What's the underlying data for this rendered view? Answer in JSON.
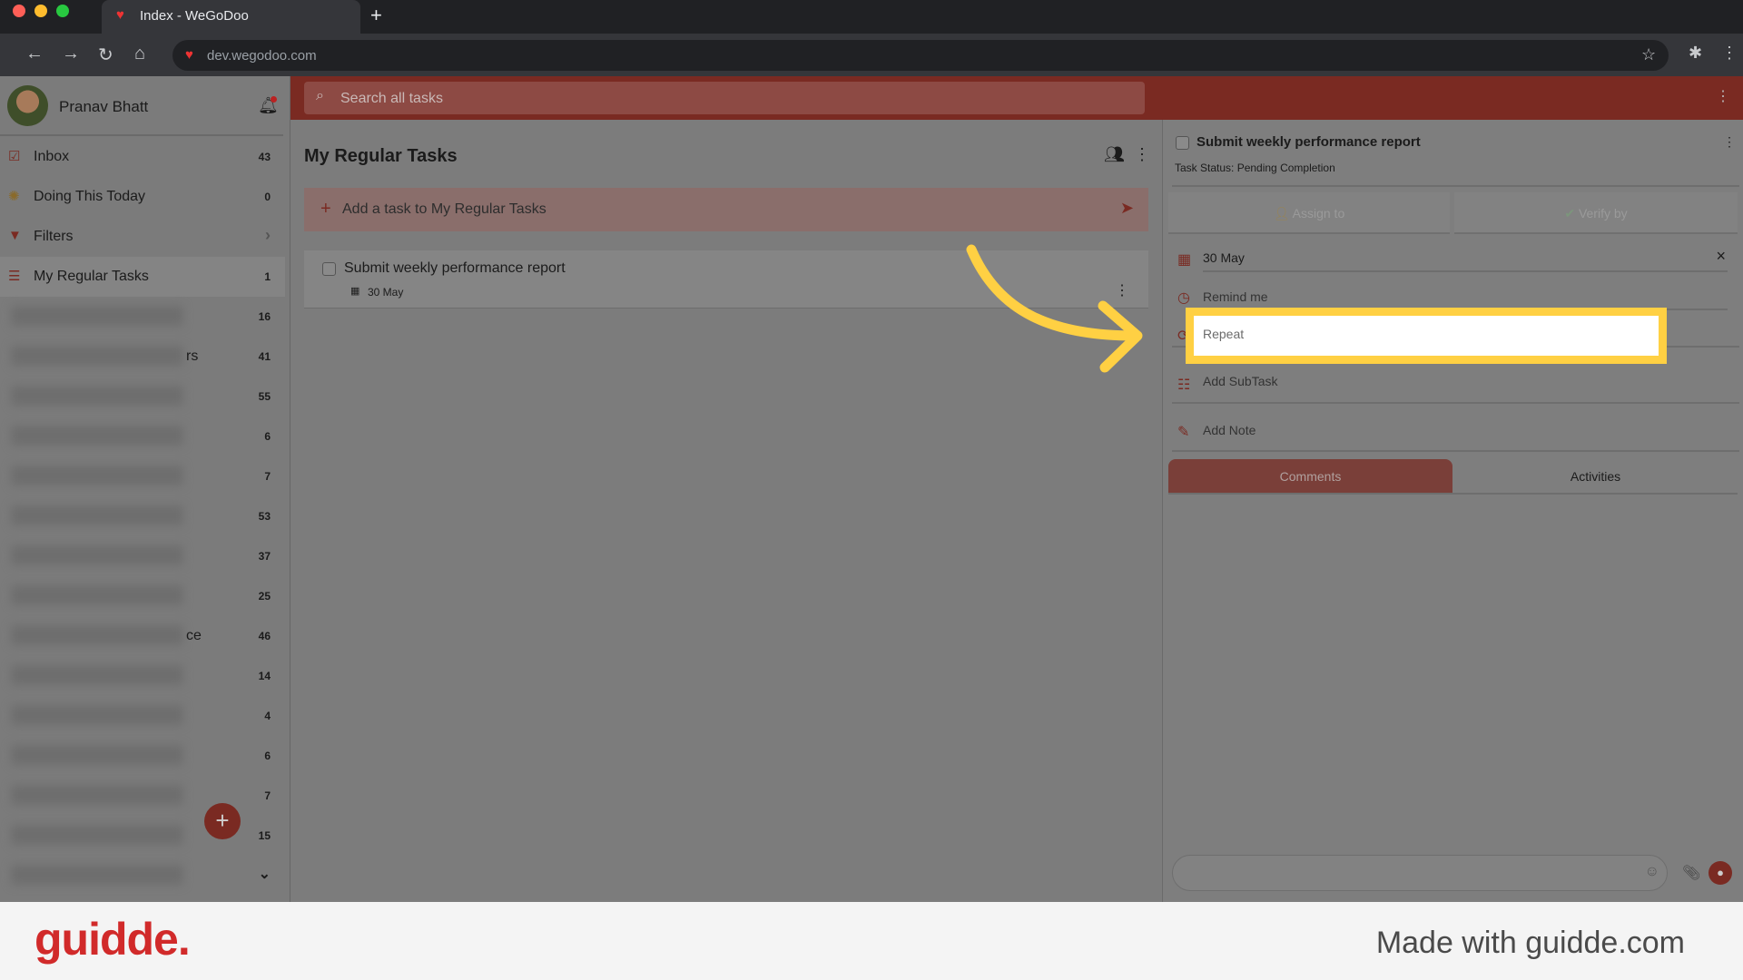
{
  "browser": {
    "tab_title": "Index - WeGoDoo",
    "url": "dev.wegodoo.com",
    "new_tab": "+"
  },
  "user": {
    "name": "Pranav Bhatt"
  },
  "sidebar": {
    "items": [
      {
        "label": "Inbox",
        "count": "43",
        "icon": "check-square-icon"
      },
      {
        "label": "Doing This Today",
        "count": "0",
        "icon": "sun-icon"
      },
      {
        "label": "Filters",
        "count": "",
        "icon": "filter-icon"
      },
      {
        "label": "My Regular Tasks",
        "count": "1",
        "icon": "list-icon"
      }
    ],
    "blurred_items": [
      {
        "count": "16",
        "fragment": ""
      },
      {
        "count": "41",
        "fragment": "rs"
      },
      {
        "count": "55",
        "fragment": ""
      },
      {
        "count": "6",
        "fragment": ""
      },
      {
        "count": "7",
        "fragment": ""
      },
      {
        "count": "53",
        "fragment": ""
      },
      {
        "count": "37",
        "fragment": ""
      },
      {
        "count": "25",
        "fragment": ""
      },
      {
        "count": "46",
        "fragment": "ce"
      },
      {
        "count": "14",
        "fragment": ""
      },
      {
        "count": "4",
        "fragment": ""
      },
      {
        "count": "6",
        "fragment": ""
      },
      {
        "count": "7",
        "fragment": ""
      },
      {
        "count": "15",
        "fragment": ""
      },
      {
        "count": "",
        "fragment": ""
      }
    ]
  },
  "search": {
    "placeholder": "Search all tasks"
  },
  "list": {
    "title": "My Regular Tasks",
    "add_placeholder": "Add a task to My Regular Tasks",
    "tasks": [
      {
        "title": "Submit weekly performance report",
        "date": "30 May"
      }
    ]
  },
  "detail": {
    "title": "Submit weekly performance report",
    "status": "Task Status: Pending Completion",
    "assign": "Assign to",
    "verify": "Verify by",
    "due": "30 May",
    "remind": "Remind me",
    "repeat": "Repeat",
    "subtask": "Add SubTask",
    "note": "Add Note",
    "tabs": [
      "Comments",
      "Activities"
    ],
    "active_tab": "Comments"
  },
  "colors": {
    "brand": "#c0392b",
    "highlight": "#ffd043"
  },
  "footer": {
    "logo": "guidde.",
    "made_with": "Made with guidde.com"
  }
}
